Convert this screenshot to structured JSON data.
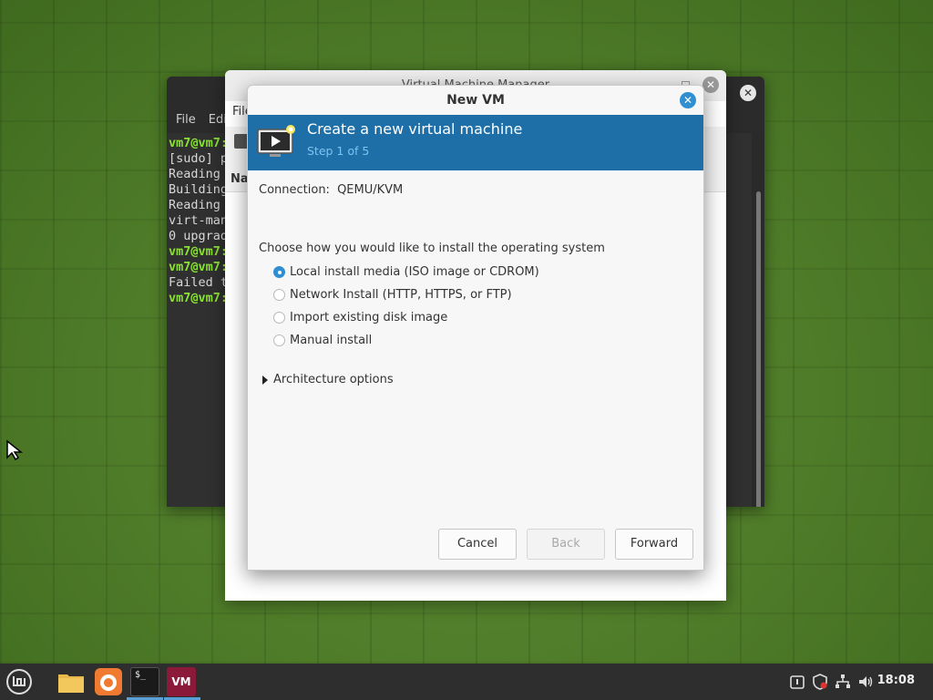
{
  "terminal": {
    "menu": [
      "File",
      "Edi"
    ],
    "lines": [
      {
        "prompt": "vm7@vm7:",
        "text": ""
      },
      {
        "prompt": "",
        "text": "[sudo] p"
      },
      {
        "prompt": "",
        "text": "Reading "
      },
      {
        "prompt": "",
        "text": "Building"
      },
      {
        "prompt": "",
        "text": "Reading "
      },
      {
        "prompt": "",
        "text": "virt-man"
      },
      {
        "prompt": "",
        "text": "0 upgrad"
      },
      {
        "prompt": "vm7@vm7:",
        "text": ""
      },
      {
        "prompt": "vm7@vm7:",
        "text": ""
      },
      {
        "prompt": "",
        "text": "Failed t"
      },
      {
        "prompt": "vm7@vm7:",
        "text": ""
      }
    ]
  },
  "vmm": {
    "title": "Virtual Machine Manager",
    "menu": "File",
    "column_header": "Na"
  },
  "dialog": {
    "title": "New VM",
    "banner_title": "Create a new virtual machine",
    "banner_step": "Step 1 of 5",
    "connection_label": "Connection:",
    "connection_value": "QEMU/KVM",
    "prompt": "Choose how you would like to install the operating system",
    "options": [
      {
        "label": "Local install media (ISO image or CDROM)",
        "checked": true
      },
      {
        "label": "Network Install (HTTP, HTTPS, or FTP)",
        "checked": false
      },
      {
        "label": "Import existing disk image",
        "checked": false
      },
      {
        "label": "Manual install",
        "checked": false
      }
    ],
    "expander_label": "Architecture options",
    "buttons": {
      "cancel": "Cancel",
      "back": "Back",
      "forward": "Forward"
    }
  },
  "taskbar": {
    "clock": "18:08",
    "apps": [
      "menu-icon",
      "files-icon",
      "firefox-icon",
      "terminal-icon",
      "virt-manager-icon"
    ],
    "vm_label": "VM",
    "terminal_label": "$_",
    "accent_color": "#5aa0d8"
  },
  "colors": {
    "banner": "#1e6fa8",
    "banner_sub": "#7fc3ef",
    "selected_radio": "#2f8fd1",
    "terminal_prompt": "#8ae234"
  }
}
